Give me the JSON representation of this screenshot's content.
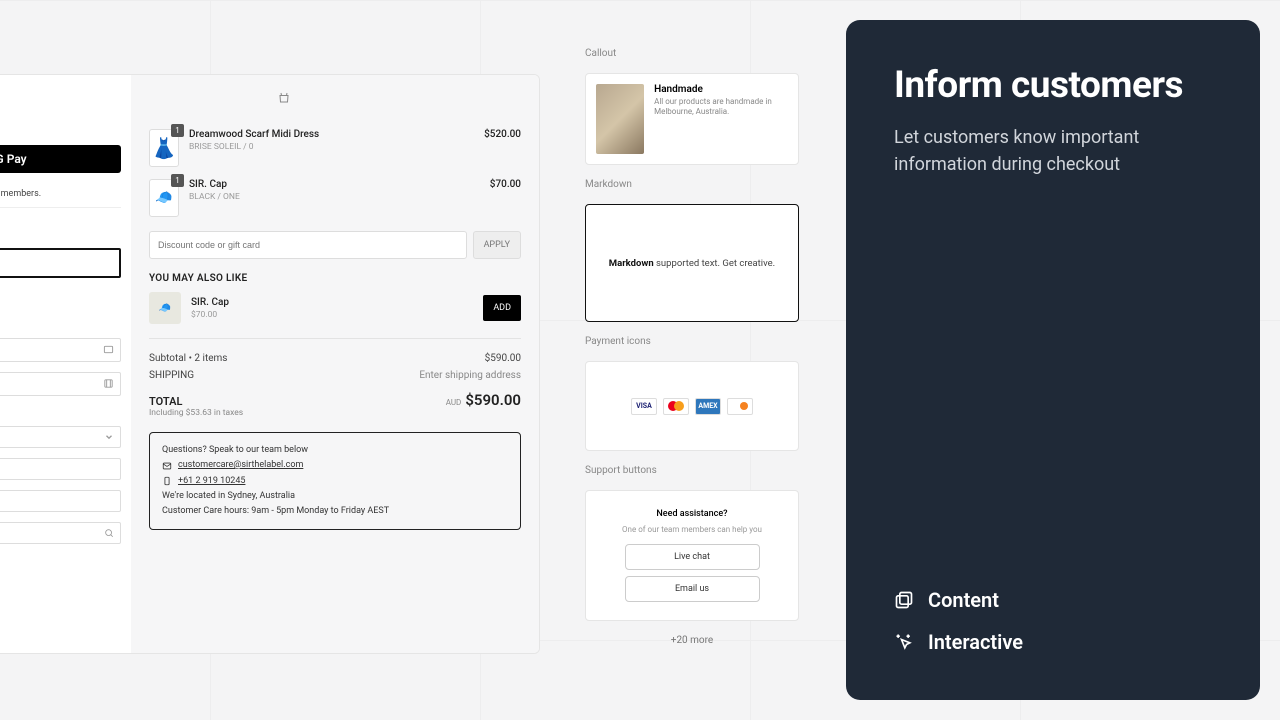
{
  "checkout": {
    "gpay_label": "G Pay",
    "benefits_text": "Enjoy benefits and rewards members.",
    "items": [
      {
        "qty": "1",
        "name": "Dreamwood Scarf Midi Dress",
        "variant": "BRISE SOLEIL / 0",
        "price": "$520.00"
      },
      {
        "qty": "1",
        "name": "SIR. Cap",
        "variant": "BLACK / ONE",
        "price": "$70.00"
      }
    ],
    "discount_placeholder": "Discount code or gift card",
    "apply_label": "APPLY",
    "upsell_title": "YOU MAY ALSO LIKE",
    "upsell": {
      "name": "SIR. Cap",
      "price": "$70.00",
      "add_label": "ADD"
    },
    "subtotal_label": "Subtotal • 2 items",
    "subtotal_value": "$590.00",
    "shipping_label": "SHIPPING",
    "shipping_value": "Enter shipping address",
    "total_label": "TOTAL",
    "total_sub": "Including $53.63 in taxes",
    "total_currency": "AUD",
    "total_value": "$590.00",
    "support": {
      "intro": "Questions? Speak to our team below",
      "email": "customercare@sirthelabel.com",
      "phone": "+61 2 919 10245",
      "location": "We're located in Sydney, Australia",
      "hours": "Customer Care hours: 9am - 5pm Monday to Friday AEST"
    }
  },
  "cards": {
    "callout_label": "Callout",
    "callout": {
      "title": "Handmade",
      "text": "All our products are handmade in Melbourne, Australia."
    },
    "markdown_label": "Markdown",
    "markdown_prefix": "Markdown",
    "markdown_rest": " supported text. Get creative.",
    "payments_label": "Payment icons",
    "support_label": "Support buttons",
    "support": {
      "title": "Need assistance?",
      "sub": "One of our team members can help you",
      "btn1": "Live chat",
      "btn2": "Email us"
    },
    "more": "+20 more"
  },
  "panel": {
    "title": "Inform customers",
    "subtitle": "Let customers know important information during checkout",
    "item1": "Content",
    "item2": "Interactive"
  }
}
